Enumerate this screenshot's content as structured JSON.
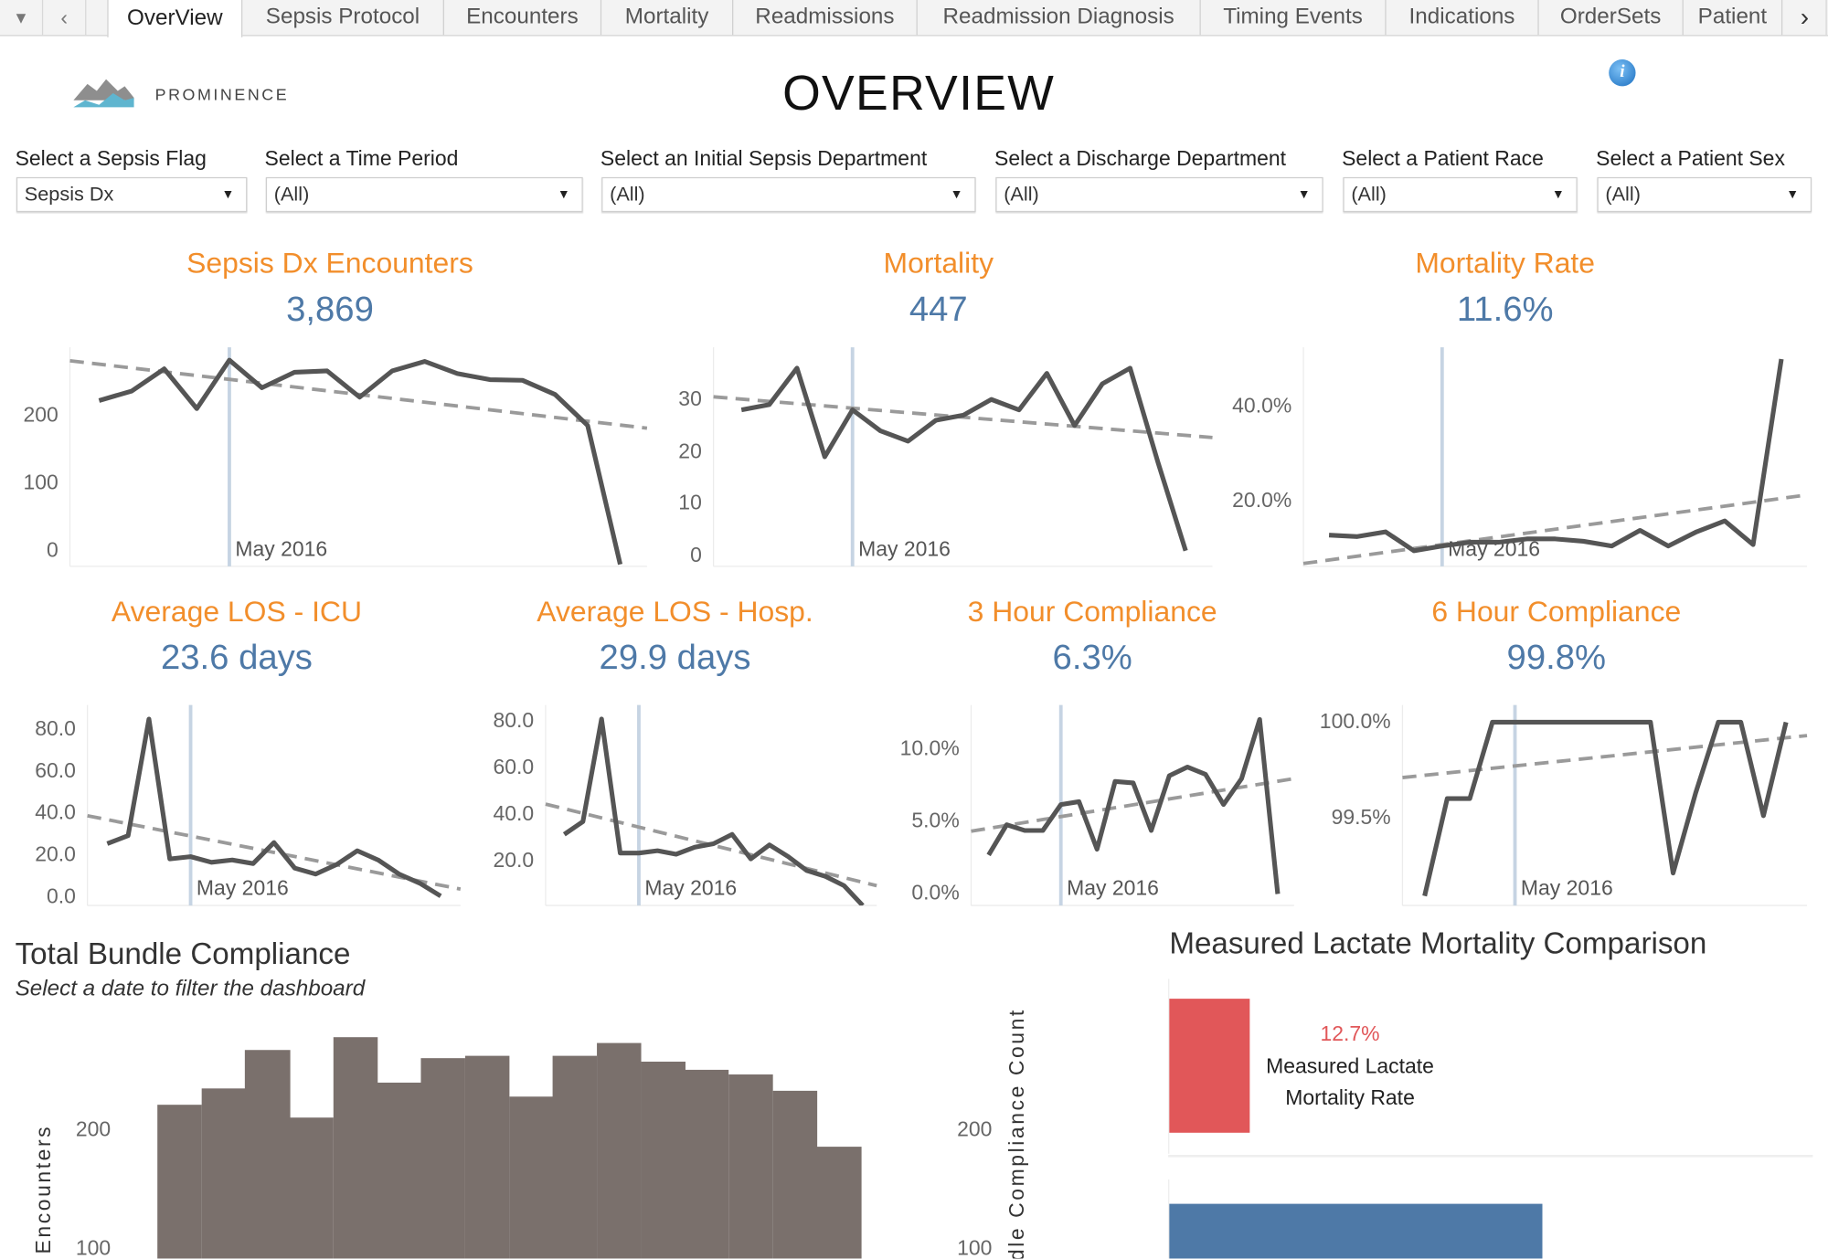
{
  "tabs": {
    "items": [
      "OverView",
      "Sepsis Protocol",
      "Encounters",
      "Mortality",
      "Readmissions",
      "Readmission Diagnosis",
      "Timing Events",
      "Indications",
      "OrderSets",
      "Patient"
    ],
    "active": "OverView",
    "prev_icon": "chevron-left-icon",
    "next_icon": "chevron-right-icon",
    "menu_icon": "caret-down-icon"
  },
  "header": {
    "logo_text": "PROMINENCE",
    "title": "OVERVIEW",
    "info_icon": "info-icon"
  },
  "filters": [
    {
      "label": "Select a Sepsis Flag",
      "value": "Sepsis Dx"
    },
    {
      "label": "Select a Time Period",
      "value": "(All)"
    },
    {
      "label": "Select an Initial Sepsis Department",
      "value": "(All)"
    },
    {
      "label": "Select a Discharge Department",
      "value": "(All)"
    },
    {
      "label": "Select a Patient Race",
      "value": "(All)"
    },
    {
      "label": "Select a Patient Sex",
      "value": "(All)"
    }
  ],
  "colors": {
    "kpi_title": "#f28e2b",
    "kpi_value": "#4e79a7",
    "line": "#555555",
    "trend": "#9a9a9a",
    "reference": "#c6d4e3",
    "bars": "#7a706c",
    "lactate_measured": "#e15759",
    "lactate_other": "#4e79a7"
  },
  "kpis": [
    {
      "title": "Sepsis Dx Encounters",
      "value": "3,869"
    },
    {
      "title": "Mortality",
      "value": "447"
    },
    {
      "title": "Mortality Rate",
      "value": "11.6%"
    },
    {
      "title": "Average LOS - ICU",
      "value": "23.6 days"
    },
    {
      "title": "Average LOS - Hosp.",
      "value": "29.9 days"
    },
    {
      "title": "3 Hour Compliance",
      "value": "6.3%"
    },
    {
      "title": "6 Hour Compliance",
      "value": "99.8%"
    }
  ],
  "chart_data": [
    {
      "type": "line",
      "ylim": [
        -23,
        302
      ],
      "yticks": [
        {
          "v": 0,
          "t": "0"
        },
        {
          "v": 100,
          "t": "100"
        },
        {
          "v": 200,
          "t": "200"
        }
      ],
      "values": [
        223,
        237,
        270,
        211,
        283,
        242,
        265,
        267,
        228,
        267,
        281,
        263,
        254,
        253,
        232,
        186,
        -20
      ],
      "trend": [
        282,
        182
      ],
      "reference_index": 4,
      "reference_label": "May 2016"
    },
    {
      "type": "line",
      "ylim": [
        -2,
        40
      ],
      "yticks": [
        {
          "v": 0,
          "t": "0"
        },
        {
          "v": 10,
          "t": "10"
        },
        {
          "v": 20,
          "t": "20"
        },
        {
          "v": 30,
          "t": "30"
        }
      ],
      "values": [
        28,
        29,
        36,
        19,
        28,
        24,
        22,
        26,
        27,
        30,
        28,
        35,
        25,
        33,
        36,
        18,
        1
      ],
      "trend": [
        30.5,
        22.7
      ],
      "reference_index": 4,
      "reference_label": "May 2016"
    },
    {
      "type": "line",
      "ylim": [
        6.2,
        52.5
      ],
      "yticks": [
        {
          "v": 20,
          "t": "20.0%"
        },
        {
          "v": 40,
          "t": "40.0%"
        }
      ],
      "values": [
        12.8,
        12.5,
        13.5,
        9.5,
        10.5,
        11.3,
        11.3,
        12,
        12,
        11.5,
        10.5,
        13.8,
        10.5,
        13.5,
        15.8,
        10.8,
        50
      ],
      "trend": [
        6.8,
        21.3
      ],
      "reference_index": 4,
      "reference_label": "May 2016"
    },
    {
      "type": "line",
      "ylim": [
        -3.9,
        91.7
      ],
      "yticks": [
        {
          "v": 0,
          "t": "0.0"
        },
        {
          "v": 20,
          "t": "20.0"
        },
        {
          "v": 40,
          "t": "40.0"
        },
        {
          "v": 60,
          "t": "60.0"
        },
        {
          "v": 80,
          "t": "80.0"
        }
      ],
      "values": [
        25.6,
        29.4,
        85,
        18.3,
        19.4,
        16.7,
        17.8,
        16.1,
        26.1,
        13.9,
        11.1,
        15.6,
        22.2,
        17.8,
        11.1,
        6.7,
        0.6
      ],
      "trend": [
        38.9,
        3.9
      ],
      "reference_index": 4,
      "reference_label": "May 2016"
    },
    {
      "type": "line",
      "ylim": [
        1,
        87
      ],
      "yticks": [
        {
          "v": 20,
          "t": "20.0"
        },
        {
          "v": 40,
          "t": "40.0"
        },
        {
          "v": 60,
          "t": "60.0"
        },
        {
          "v": 80,
          "t": "80.0"
        }
      ],
      "values": [
        31.5,
        37,
        81,
        23.5,
        23.5,
        24.5,
        23,
        26,
        27.5,
        31.5,
        21,
        27,
        22,
        16,
        13.5,
        9.5,
        1
      ],
      "trend": [
        44.5,
        9.5
      ],
      "reference_index": 4,
      "reference_label": "May 2016"
    },
    {
      "type": "line",
      "ylim": [
        -0.8,
        13.1
      ],
      "yticks": [
        {
          "v": 0,
          "t": "0.0%"
        },
        {
          "v": 5,
          "t": "5.0%"
        },
        {
          "v": 10,
          "t": "10.0%"
        }
      ],
      "values": [
        2.7,
        4.8,
        4.4,
        4.4,
        6.2,
        6.4,
        3.1,
        7.8,
        7.7,
        4.4,
        8.2,
        8.8,
        8.3,
        6.2,
        8.0,
        12.1,
        0
      ],
      "trend": [
        4.35,
        8.0
      ],
      "reference_index": 4,
      "reference_label": "May 2016"
    },
    {
      "type": "line",
      "ylim": [
        99.04,
        100.09
      ],
      "yticks": [
        {
          "v": 99.5,
          "t": "99.5%"
        },
        {
          "v": 100,
          "t": "100.0%"
        }
      ],
      "values": [
        99.09,
        99.6,
        99.6,
        100,
        100,
        100,
        100,
        100,
        100,
        100,
        100,
        99.21,
        99.63,
        100,
        100,
        99.51,
        100
      ],
      "trend": [
        99.71,
        99.93
      ],
      "reference_index": 4,
      "reference_label": "May 2016"
    },
    {
      "type": "bar",
      "title": "Total Bundle Compliance",
      "subtitle": "Select a date to filter the dashboard",
      "ylabel": "Encounters",
      "y2label": "Bundle Compliance Count",
      "yticks": [
        {
          "v": 100,
          "t": "100"
        },
        {
          "v": 200,
          "t": "200"
        }
      ],
      "values": [
        222,
        235,
        268,
        211,
        278,
        240,
        261,
        263,
        228,
        263,
        274,
        258,
        251,
        247,
        233,
        186
      ]
    },
    {
      "type": "bar",
      "title": "Measured Lactate Mortality Comparison",
      "bars": [
        {
          "label": "Measured Lactate Mortality Rate",
          "label_lines": [
            "Measured Lactate",
            "Mortality Rate"
          ],
          "value_label": "12.7%",
          "value": 12.7
        }
      ]
    }
  ]
}
